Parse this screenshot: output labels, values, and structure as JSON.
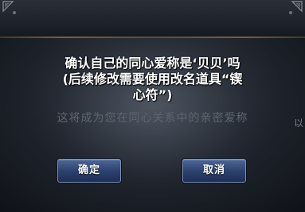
{
  "dialog": {
    "message_line1": "确认自己的同心爱称是‘贝贝’吗",
    "message_line2": "(后续修改需要使用改名道具“锲",
    "message_line3": "心符”)",
    "background_hint": "这将成为您在同心关系中的亲密爱称",
    "right_edge_hint": "以",
    "confirm_label": "确定",
    "cancel_label": "取消"
  },
  "colors": {
    "button_top": "#4e6797",
    "button_bottom": "#1f2f55",
    "button_border": "#7c8fb6",
    "message_text": "#ffffff",
    "hint_text": "#5f6670"
  },
  "icons": {
    "corner_ornament_left": "corner-ornament-icon",
    "corner_ornament_right": "corner-ornament-icon"
  }
}
